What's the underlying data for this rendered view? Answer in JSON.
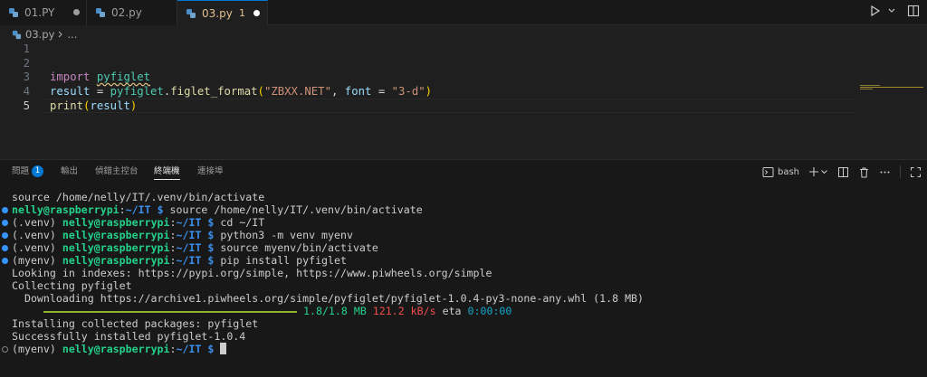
{
  "tabs": [
    {
      "label": "01.PY",
      "dirty": true
    },
    {
      "label": "02.py",
      "dirty": false
    },
    {
      "label": "03.py",
      "problems": "1",
      "dirty": true,
      "active": true
    }
  ],
  "breadcrumb": {
    "file": "03.py",
    "more": "..."
  },
  "editor": {
    "lines": [
      {
        "n": "1"
      },
      {
        "n": "2"
      },
      {
        "n": "3",
        "kw": "import",
        "mod": "pyfiglet"
      },
      {
        "n": "4",
        "var": "result",
        "eq": " = ",
        "mod": "pyfiglet",
        "dot": ".",
        "fn": "figlet_format",
        "open": "(",
        "str1": "\"ZBXX.NET\"",
        "comma": ", ",
        "kwarg": "font",
        "eq2": " = ",
        "str2": "\"3-d\"",
        "close": ")"
      },
      {
        "n": "5",
        "fn": "print",
        "open": "(",
        "var": "result",
        "close": ")"
      }
    ],
    "current_line": "5"
  },
  "panel": {
    "tabs": [
      "問題",
      "輸出",
      "偵錯主控台",
      "終端機",
      "連接埠"
    ],
    "problems_count": "1",
    "active_tab": "終端機",
    "shell": "bash"
  },
  "terminal": {
    "user": "nelly@raspberrypi",
    "lines": [
      {
        "plain": "source /home/nelly/IT/.venv/bin/activate"
      },
      {
        "prefix": "",
        "cwd": "~/IT",
        "cmd": "source /home/nelly/IT/.venv/bin/activate"
      },
      {
        "prefix": "(.venv) ",
        "cwd": "~/IT",
        "cmd": "cd ~/IT"
      },
      {
        "prefix": "(.venv) ",
        "cwd": "~/IT",
        "cmd": "python3 -m venv myenv"
      },
      {
        "prefix": "(.venv) ",
        "cwd": "~/IT",
        "cmd": "source myenv/bin/activate"
      },
      {
        "prefix": "(myenv) ",
        "cwd": "~/IT",
        "cmd": "pip install pyfiglet"
      },
      {
        "plain": "Looking in indexes: https://pypi.org/simple, https://www.piwheels.org/simple"
      },
      {
        "plain": "Collecting pyfiglet"
      },
      {
        "plain": "  Downloading https://archive1.piwheels.org/simple/pyfiglet/pyfiglet-1.0.4-py3-none-any.whl (1.8 MB)"
      },
      {
        "progress": "1.8/1.8 MB",
        "rate": "121.2 kB/s",
        "eta_label": "eta",
        "eta": "0:00:00"
      },
      {
        "plain": "Installing collected packages: pyfiglet"
      },
      {
        "plain": "Successfully installed pyfiglet-1.0.4"
      },
      {
        "prefix": "(myenv) ",
        "cwd": "~/IT",
        "cmd": ""
      }
    ],
    "prompt_sep": ":",
    "prompt_dollar": "$",
    "download_progress": 1.0
  }
}
